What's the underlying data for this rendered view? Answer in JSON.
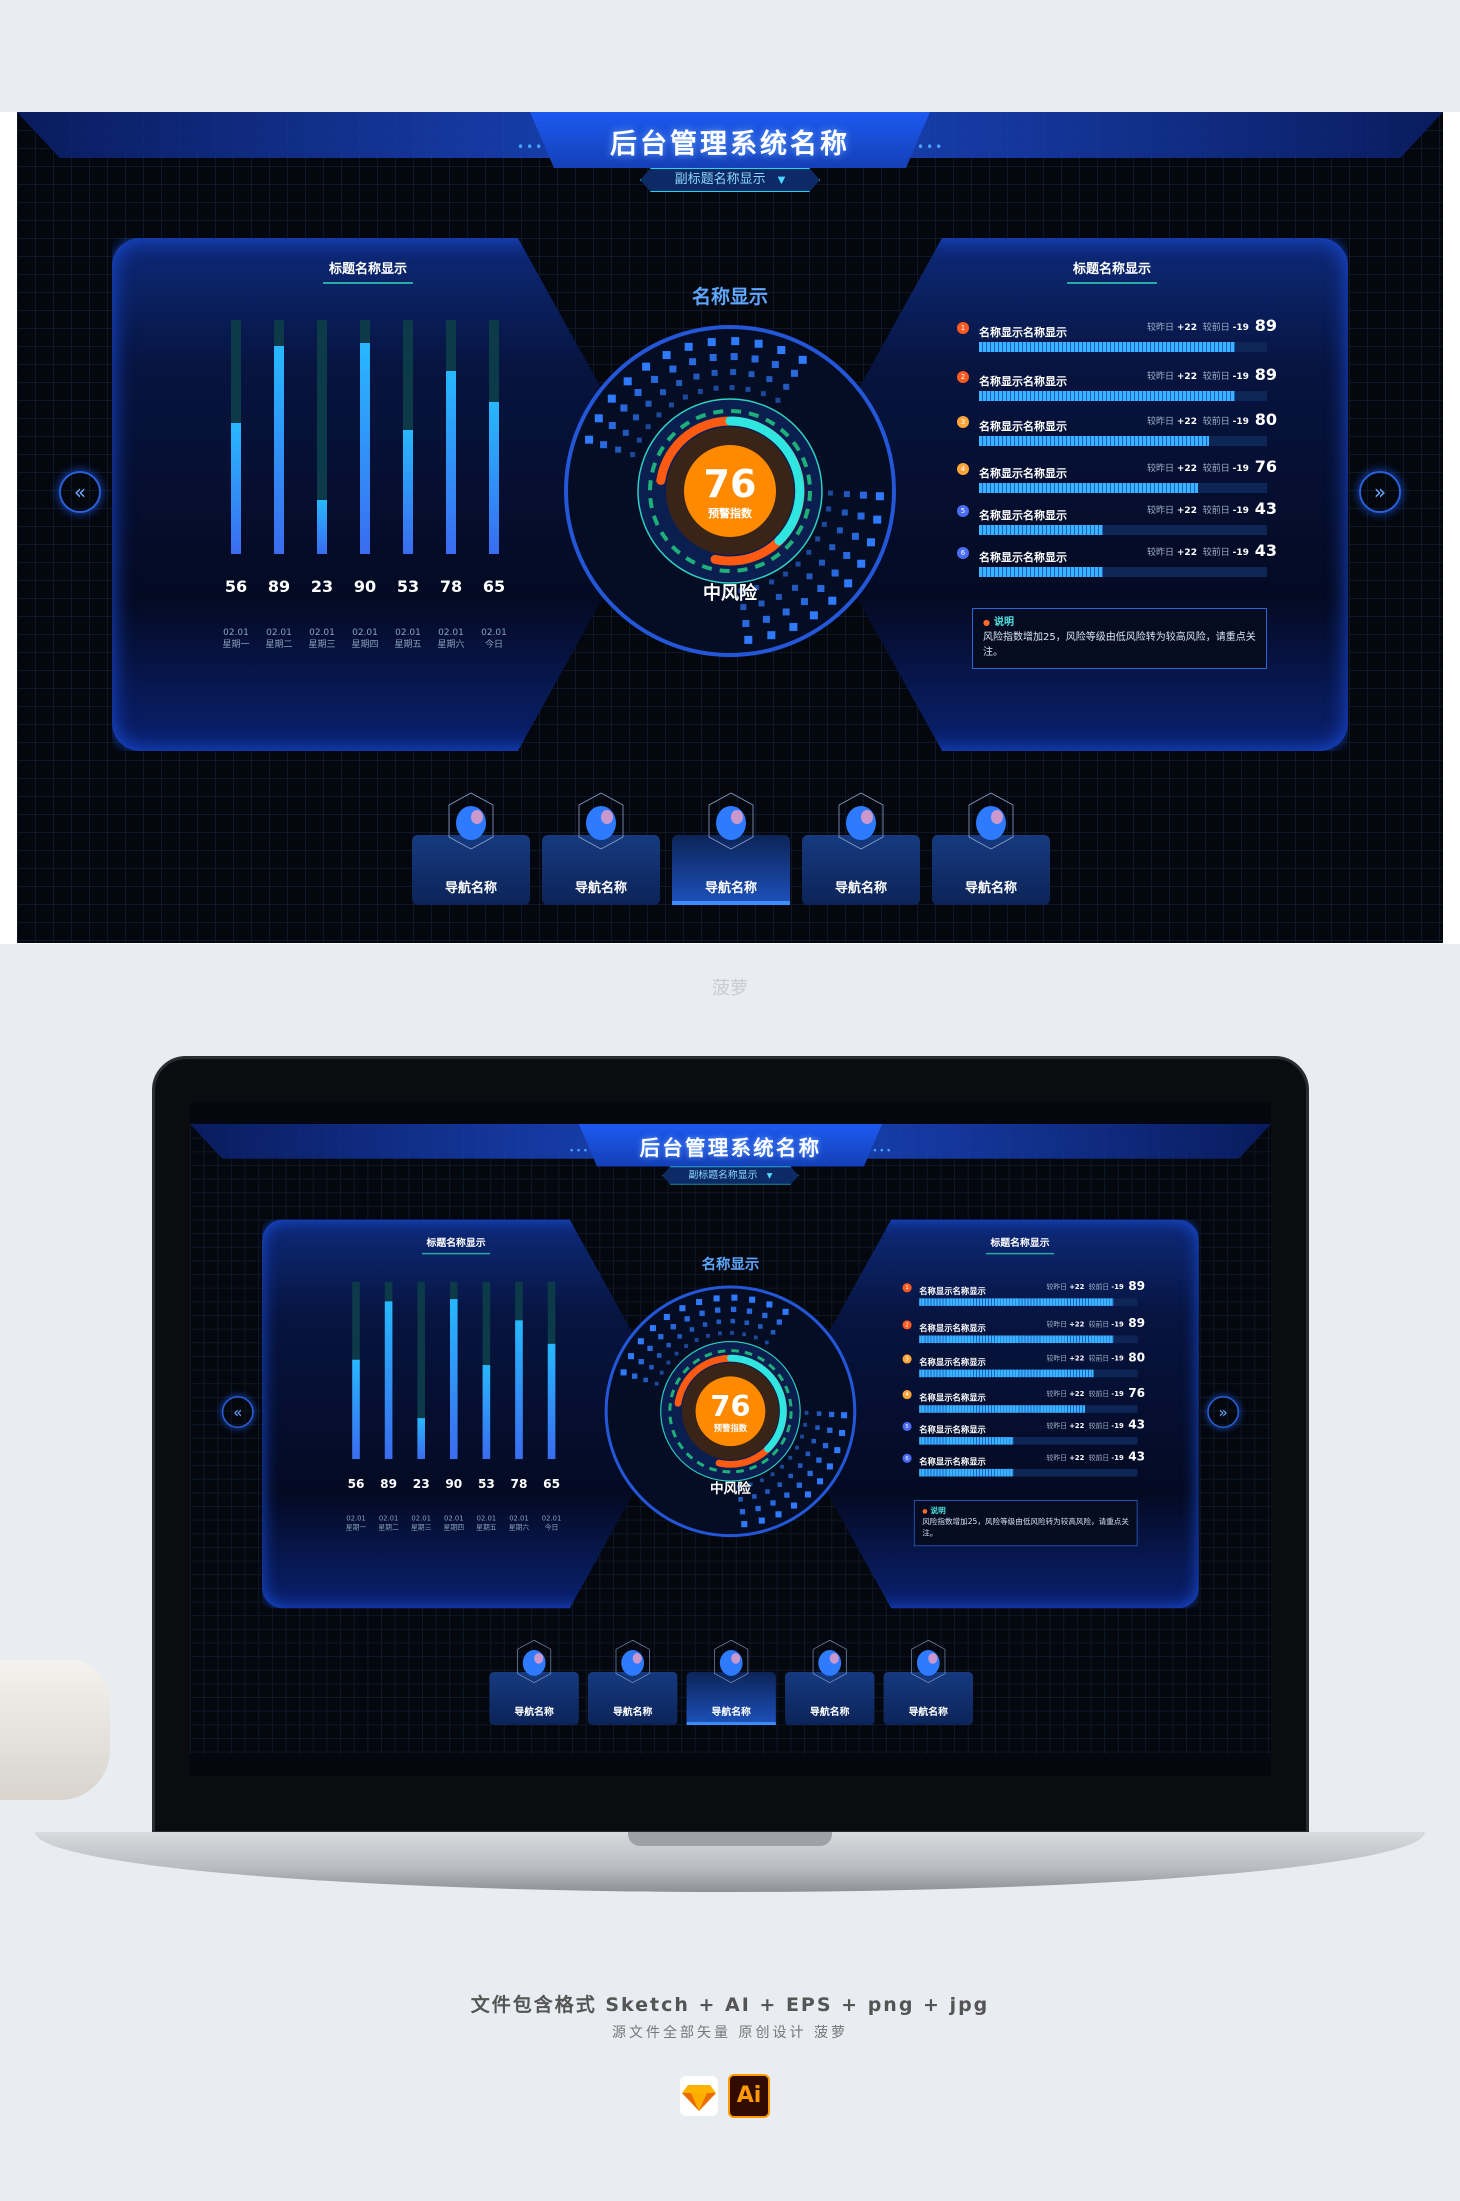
{
  "header": {
    "title": "后台管理系统名称",
    "subtitle": "副标题名称显示"
  },
  "left_panel": {
    "title": "标题名称显示"
  },
  "chart_data": {
    "type": "bar",
    "categories": [
      "星期一",
      "星期二",
      "星期三",
      "星期四",
      "星期五",
      "星期六",
      "今日"
    ],
    "dates": [
      "02.01",
      "02.01",
      "02.01",
      "02.01",
      "02.01",
      "02.01",
      "02.01"
    ],
    "values": [
      56,
      89,
      23,
      90,
      53,
      78,
      65
    ],
    "ylim": [
      0,
      100
    ],
    "grid": false
  },
  "center": {
    "title": "名称显示",
    "score": "76",
    "score_label": "预警指数",
    "risk_level": "中风险",
    "score_value": 76
  },
  "right_panel": {
    "title": "标题名称显示",
    "rows": [
      {
        "rank": "1",
        "name": "名称显示名称显示",
        "cmp1_label": "较昨日",
        "cmp1": "+22",
        "cmp2_label": "较前日",
        "cmp2": "-19",
        "value": "89",
        "color": "#ff5a1f"
      },
      {
        "rank": "2",
        "name": "名称显示名称显示",
        "cmp1_label": "较昨日",
        "cmp1": "+22",
        "cmp2_label": "较前日",
        "cmp2": "-19",
        "value": "89",
        "color": "#ff5a1f"
      },
      {
        "rank": "3",
        "name": "名称显示名称显示",
        "cmp1_label": "较昨日",
        "cmp1": "+22",
        "cmp2_label": "较前日",
        "cmp2": "-19",
        "value": "80",
        "color": "#ffa53a"
      },
      {
        "rank": "4",
        "name": "名称显示名称显示",
        "cmp1_label": "较昨日",
        "cmp1": "+22",
        "cmp2_label": "较前日",
        "cmp2": "-19",
        "value": "76",
        "color": "#ffa53a"
      },
      {
        "rank": "5",
        "name": "名称显示名称显示",
        "cmp1_label": "较昨日",
        "cmp1": "+22",
        "cmp2_label": "较前日",
        "cmp2": "-19",
        "value": "43",
        "color": "#4a6cf0"
      },
      {
        "rank": "6",
        "name": "名称显示名称显示",
        "cmp1_label": "较昨日",
        "cmp1": "+22",
        "cmp2_label": "较前日",
        "cmp2": "-19",
        "value": "43",
        "color": "#4a6cf0"
      }
    ],
    "note_title": "说明",
    "note_text": "风险指数增加25，风险等级由低风险转为较高风险，请重点关注。"
  },
  "nav": [
    {
      "label": "导航名称",
      "icon": "robot-icon"
    },
    {
      "label": "导航名称",
      "icon": "cubes-icon"
    },
    {
      "label": "导航名称",
      "icon": "planet-icon",
      "active": true
    },
    {
      "label": "导航名称",
      "icon": "box-icon"
    },
    {
      "label": "导航名称",
      "icon": "user-icon"
    }
  ],
  "arrows": {
    "prev": "«",
    "next": "»"
  },
  "watermark": "菠萝",
  "footer": {
    "formats": "文件包含格式 Sketch + AI + EPS + png + jpg",
    "credits": "源文件全部矢量 原创设计 菠萝",
    "ai_label": "Ai"
  },
  "colors": {
    "accent": "#1b4fd6",
    "bar": "#27b8ff",
    "warning": "#ff8a00",
    "teal": "#2fe6e0"
  }
}
